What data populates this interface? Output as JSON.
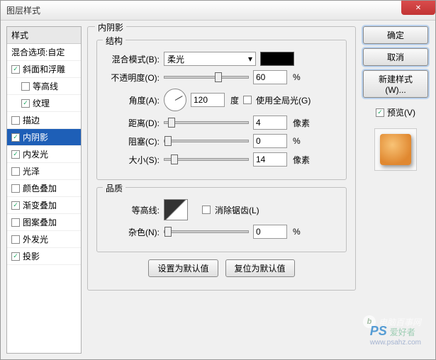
{
  "window": {
    "title": "图层样式"
  },
  "sidebar": {
    "header": "样式",
    "blending": "混合选项:自定",
    "items": [
      {
        "label": "斜面和浮雕",
        "checked": true,
        "indent": false
      },
      {
        "label": "等高线",
        "checked": false,
        "indent": true
      },
      {
        "label": "纹理",
        "checked": true,
        "indent": true
      },
      {
        "label": "描边",
        "checked": false,
        "indent": false
      },
      {
        "label": "内阴影",
        "checked": true,
        "indent": false,
        "selected": true
      },
      {
        "label": "内发光",
        "checked": true,
        "indent": false
      },
      {
        "label": "光泽",
        "checked": false,
        "indent": false
      },
      {
        "label": "颜色叠加",
        "checked": false,
        "indent": false
      },
      {
        "label": "渐变叠加",
        "checked": true,
        "indent": false
      },
      {
        "label": "图案叠加",
        "checked": false,
        "indent": false
      },
      {
        "label": "外发光",
        "checked": false,
        "indent": false
      },
      {
        "label": "投影",
        "checked": true,
        "indent": false
      }
    ]
  },
  "panel": {
    "title": "内阴影",
    "structure": {
      "legend": "结构",
      "blend_mode_label": "混合模式(B):",
      "blend_mode_value": "柔光",
      "opacity_label": "不透明度(O):",
      "opacity_value": "60",
      "opacity_unit": "%",
      "angle_label": "角度(A):",
      "angle_value": "120",
      "angle_unit": "度",
      "global_light_label": "使用全局光(G)",
      "distance_label": "距离(D):",
      "distance_value": "4",
      "distance_unit": "像素",
      "choke_label": "阻塞(C):",
      "choke_value": "0",
      "choke_unit": "%",
      "size_label": "大小(S):",
      "size_value": "14",
      "size_unit": "像素"
    },
    "quality": {
      "legend": "品质",
      "contour_label": "等高线:",
      "antialias_label": "消除锯齿(L)",
      "noise_label": "杂色(N):",
      "noise_value": "0",
      "noise_unit": "%"
    },
    "buttons": {
      "make_default": "设置为默认值",
      "reset_default": "复位为默认值"
    }
  },
  "right": {
    "ok": "确定",
    "cancel": "取消",
    "new_style": "新建样式(W)...",
    "preview_label": "预览(V)"
  },
  "watermarks": {
    "w1": "电脑百事网",
    "w2_ps": "PS",
    "w2_text": "爱好者",
    "w2_url": "www.psahz.com"
  }
}
